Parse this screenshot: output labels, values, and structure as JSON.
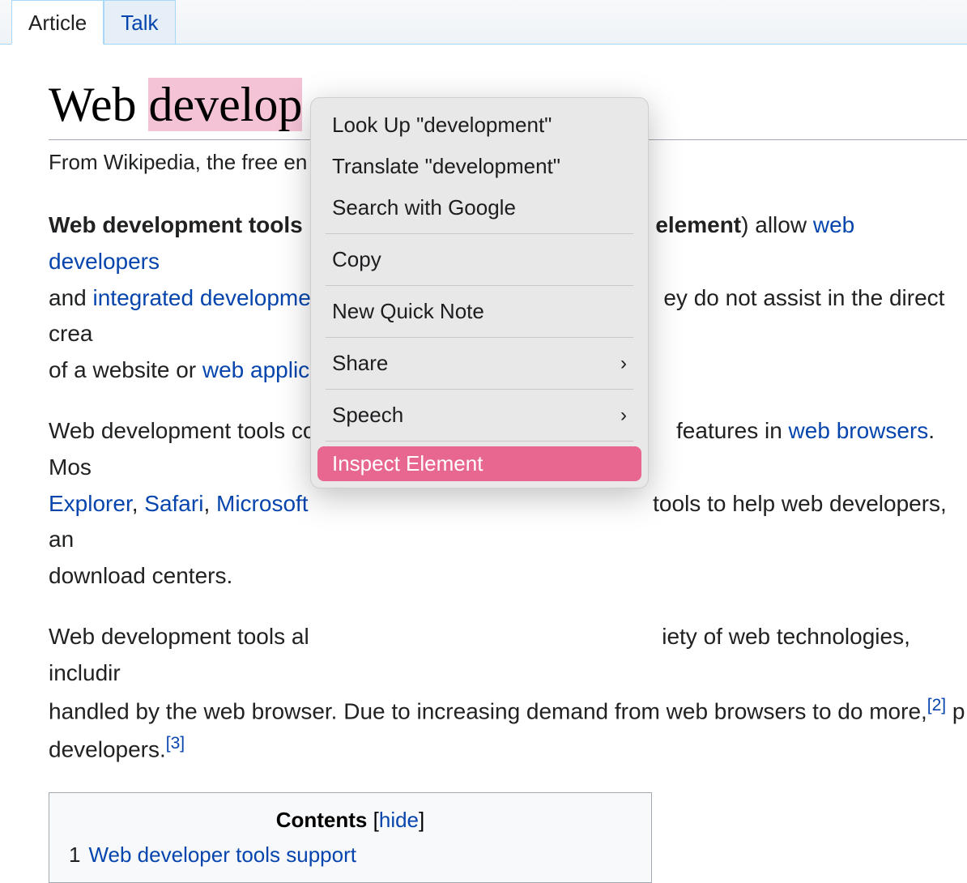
{
  "tabs": {
    "article": "Article",
    "talk": "Talk"
  },
  "title": {
    "pre": "Web ",
    "highlighted": "develop",
    "post": ""
  },
  "subtitle": "From Wikipedia, the free en",
  "para1": {
    "b1": "Web development tools",
    "b2": "element",
    "t1": ") allow ",
    "l1": "web developers",
    "t2": "and ",
    "l2": "integrated developme",
    "t3": "ey do not assist in the direct crea",
    "t4": "of a website or ",
    "l3": "web applic"
  },
  "para2": {
    "t1": "Web development tools co",
    "t2": "features in ",
    "l1": "web browsers",
    "t3": ". Mos",
    "l2": "Explorer",
    "c1": ", ",
    "l3": "Safari",
    "c2": ", ",
    "l4": "Microsoft",
    "t4": "tools to help web developers, an",
    "t5": "download centers."
  },
  "para3": {
    "t1": "Web development tools al",
    "t2": "iety of web technologies, includir",
    "t3": "handled by the web browser. Due to increasing demand from web browsers to do more,",
    "sup1": "[2]",
    "t4": " p",
    "t5": "developers.",
    "sup2": "[3]"
  },
  "toc": {
    "title": "Contents",
    "hide": "hide",
    "items": [
      {
        "num": "1",
        "label": "Web developer tools support"
      }
    ]
  },
  "menu": {
    "lookup": "Look Up \"development\"",
    "translate": "Translate \"development\"",
    "search": "Search with Google",
    "copy": "Copy",
    "quicknote": "New Quick Note",
    "share": "Share",
    "speech": "Speech",
    "inspect": "Inspect Element"
  }
}
